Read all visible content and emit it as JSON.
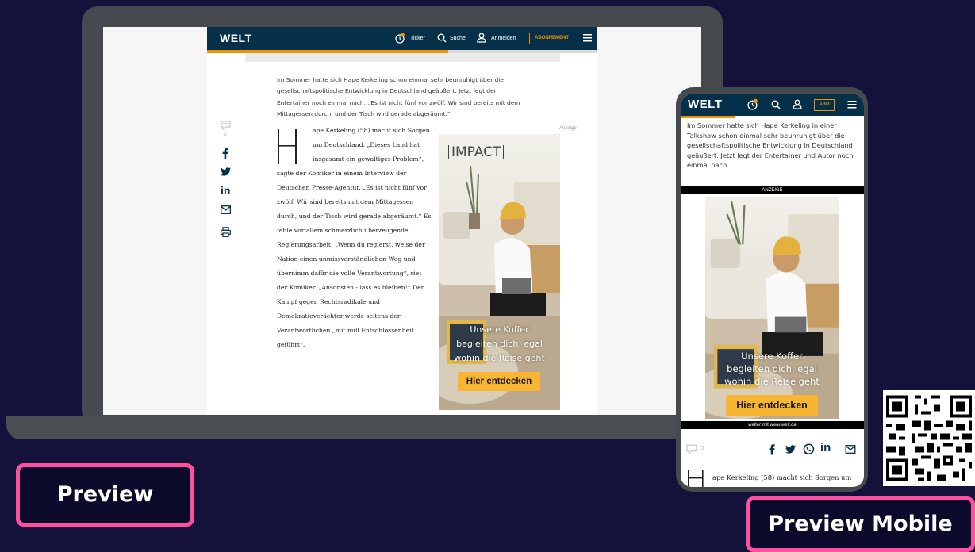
{
  "colors": {
    "background": "#14123a",
    "accent_pink": "#ff4fa0",
    "welt_navy": "#06304a",
    "welt_orange": "#f39200",
    "ad_cta": "#f8b531"
  },
  "desktop": {
    "nav": {
      "logo": "WELT",
      "ticker": "Ticker",
      "search": "Suche",
      "login": "Anmelden",
      "subscribe": "ABONNEMENT"
    },
    "intro": "Im Sommer hatte sich Hape Kerkeling schon einmal sehr beunruhigt über die gesellschaftspolitische Entwicklung in Deutschland geäußert. Jetzt legt der Entertainer noch einmal nach: „Es ist nicht fünf vor zwölf. Wir sind bereits mit dem Mittagessen durch, und der Tisch wird gerade abgeräumt.“",
    "comment_count": "0",
    "body_lines": [
      "ape Kerkeling (58) macht sich Sorgen",
      "um Deutschland. „Dieses Land hat",
      "insgesamt ein gewaltiges Problem“,",
      "sagte der Komiker in einem Interview der",
      "Deutschen Presse-Agentur. „Es ist nicht fünf vor",
      "zwölf. Wir sind bereits mit dem Mittagessen",
      "durch, und der Tisch wird gerade abgeräumt.“ Es",
      "fehle vor allem schmerzlich überzeugende",
      "Regierungsarbeit: „Wenn du regierst, weise der",
      "Nation einen unmissverständlichen Weg und",
      "übernimm dafür die volle Verantwortung“, riet",
      "der Komiker. „Ansonsten - lass es bleiben!“ Der",
      "Kampf gegen Rechtsradikale und",
      "Demokratieverächter werde seitens der",
      "Verantwortlichen „mit null Entschlossenheit",
      "geführt“."
    ],
    "ad_label": "Anzeige"
  },
  "ad": {
    "brand": "IMPACT",
    "line1": "Unsere Koffer",
    "line2": "begleiten dich, egal",
    "line3": "wohin die Reise geht",
    "cta": "Hier entdecken"
  },
  "mobile": {
    "nav": {
      "logo": "WELT",
      "subscribe": "ABO"
    },
    "intro": "Im Sommer hatte sich Hape Kerkeling in einer Talkshow schon einmal sehr beunruhigt über die gesellschaftspolitische Entwicklung in Deutschland geäußert. Jetzt legt der Entertainer und Autor noch einmal nach.",
    "anzeige_bar": "ANZEIGE",
    "weiter_bar": "weiter mit www.welt.de",
    "comment_count": "0",
    "body_line": "ape Kerkeling (58) macht sich Sorgen um"
  },
  "labels": {
    "preview": "Preview",
    "preview_mobile": "Preview Mobile"
  }
}
